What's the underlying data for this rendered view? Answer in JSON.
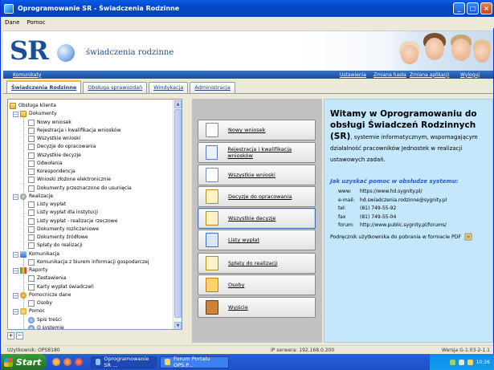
{
  "window": {
    "title": "Oprogramowanie SR - Świadczenia Rodzinne"
  },
  "menu": [
    "Dane",
    "Pomoc"
  ],
  "banner": {
    "logo": "SR",
    "brand": "świadczenia rodzinne"
  },
  "links": {
    "left": "Komunikaty",
    "right": [
      "Ustawienia",
      "Zmiana hasła",
      "Zmiana aplikacji",
      "Wyloguj"
    ]
  },
  "tabs": [
    "Świadczenia Rodzinne",
    "Obsługa sprawozdań",
    "Windykacja",
    "Administracja"
  ],
  "tree": [
    {
      "label": "Obsługa klienta",
      "level": 0,
      "icon": "folder-open-icon",
      "exp": ""
    },
    {
      "label": "Dokumenty",
      "level": 1,
      "icon": "folder-icon",
      "exp": "−"
    },
    {
      "label": "Nowy wniosek",
      "level": 2,
      "icon": "doc-icon",
      "exp": ""
    },
    {
      "label": "Rejestracja i kwalifikacja wniosków",
      "level": 2,
      "icon": "doc-icon",
      "exp": ""
    },
    {
      "label": "Wszystkie wnioski",
      "level": 2,
      "icon": "doc-icon",
      "exp": ""
    },
    {
      "label": "Decyzje do opracowania",
      "level": 2,
      "icon": "doc-icon",
      "exp": ""
    },
    {
      "label": "Wszystkie decyzje",
      "level": 2,
      "icon": "doc-icon",
      "exp": ""
    },
    {
      "label": "Odwołania",
      "level": 2,
      "icon": "doc-icon",
      "exp": ""
    },
    {
      "label": "Korespondencja",
      "level": 2,
      "icon": "doc-icon",
      "exp": ""
    },
    {
      "label": "Wnioski złożone elektronicznie",
      "level": 2,
      "icon": "doc-icon",
      "exp": ""
    },
    {
      "label": "Dokumenty przeznaczone do usunięcia",
      "level": 2,
      "icon": "doc-icon",
      "exp": ""
    },
    {
      "label": "Realizacje",
      "level": 1,
      "icon": "gear-icon",
      "exp": "−"
    },
    {
      "label": "Listy wypłat",
      "level": 2,
      "icon": "doc-icon",
      "exp": ""
    },
    {
      "label": "Listy wypłat dla instytucji",
      "level": 2,
      "icon": "doc-icon",
      "exp": ""
    },
    {
      "label": "Listy wypłat - realizacje rzeczowe",
      "level": 2,
      "icon": "doc-icon",
      "exp": ""
    },
    {
      "label": "Dokumenty rozliczeniowe",
      "level": 2,
      "icon": "doc-icon",
      "exp": ""
    },
    {
      "label": "Dokumenty źródłowe",
      "level": 2,
      "icon": "doc-icon",
      "exp": ""
    },
    {
      "label": "Spłaty do realizacji",
      "level": 2,
      "icon": "doc-icon",
      "exp": ""
    },
    {
      "label": "Komunikacja",
      "level": 1,
      "icon": "network-icon",
      "exp": "−"
    },
    {
      "label": "Komunikacja z biurem informacji gospodarczej",
      "level": 2,
      "icon": "doc-icon",
      "exp": ""
    },
    {
      "label": "Raporty",
      "level": 1,
      "icon": "chart-icon",
      "exp": "−"
    },
    {
      "label": "Zestawienia",
      "level": 2,
      "icon": "doc-icon",
      "exp": ""
    },
    {
      "label": "Karty wypłat świadczeń",
      "level": 2,
      "icon": "doc-icon",
      "exp": ""
    },
    {
      "label": "Pomocnicze dane",
      "level": 1,
      "icon": "people-icon",
      "exp": "−"
    },
    {
      "label": "Osoby",
      "level": 2,
      "icon": "doc-icon",
      "exp": ""
    },
    {
      "label": "Pomoc",
      "level": 1,
      "icon": "help-icon",
      "exp": "−"
    },
    {
      "label": "Spis treści",
      "level": 2,
      "icon": "help-doc-icon",
      "exp": ""
    },
    {
      "label": "O systemie",
      "level": 2,
      "icon": "info-icon",
      "exp": ""
    }
  ],
  "tree_buttons": [
    "+",
    "−"
  ],
  "buttons": [
    {
      "label": "Nowy wniosek",
      "icon": "new-document-icon"
    },
    {
      "label": "Rejestracja i kwalifikacja wniosków",
      "icon": "register-icon"
    },
    {
      "label": "Wszystkie wnioski",
      "icon": "documents-icon"
    },
    {
      "label": "Decyzje do opracowania",
      "icon": "edit-document-icon"
    },
    {
      "label": "Wszystkie decyzje",
      "icon": "decisions-icon"
    },
    {
      "label": "Listy wypłat",
      "icon": "payment-list-icon"
    },
    {
      "label": "Spłaty do realizacji",
      "icon": "repayment-icon"
    },
    {
      "label": "Osoby",
      "icon": "people-icon"
    },
    {
      "label": "Wyjście",
      "icon": "exit-door-icon"
    }
  ],
  "info": {
    "heading": "Witamy w Oprogramowaniu do obsługi Świadczeń Rodzinnych (SR)",
    "heading_rest": ", systemie informatycznym, wspomagającym działalność pracowników Jednostek w realizacji ustawowych zadań.",
    "help_heading": "Jak uzyskać pomoc w obsłudze systemu:",
    "contacts": [
      {
        "k": "www:",
        "v": "https://www.hd.sygnity.pl/"
      },
      {
        "k": "e-mail:",
        "v": "hd.swiadczenia.rodzinne@sygnity.pl"
      },
      {
        "k": "tel:",
        "v": "(81) 749-55-92"
      },
      {
        "k": "fax",
        "v": "(81) 749-55-04"
      },
      {
        "k": "forum:",
        "v": "http://www.public.sygnity.pl/forums/"
      }
    ],
    "manual": "Podręcznik użytkownika do pobrania w formacie PDF"
  },
  "status": {
    "user": "Użytkownik: OPS8180",
    "server": "IP serwera: 192.168.0.200",
    "version": "Wersja G-1.03-2-1.1"
  },
  "taskbar": {
    "start": "Start",
    "tasks": [
      "Oprogramowanie SR ...",
      "Forum Portalu OPS.P..."
    ],
    "clock": "10:26"
  }
}
